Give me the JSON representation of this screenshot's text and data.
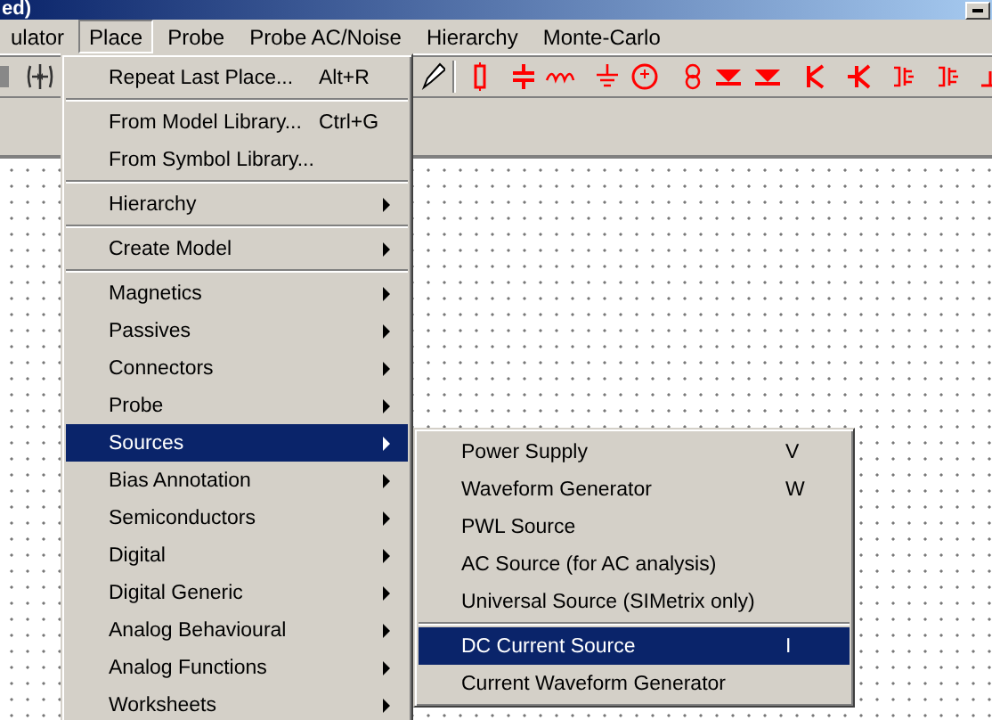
{
  "window": {
    "title": "ed)"
  },
  "menu_bar": [
    {
      "label": "ulator",
      "selected": false
    },
    {
      "label": "Place",
      "selected": true
    },
    {
      "label": "Probe",
      "selected": false
    },
    {
      "label": "Probe AC/Noise",
      "selected": false
    },
    {
      "label": "Hierarchy",
      "selected": false
    },
    {
      "label": "Monte-Carlo",
      "selected": false
    }
  ],
  "place_menu": {
    "items": [
      {
        "kind": "item",
        "label": "Repeat Last Place...",
        "shortcut": "Alt+R",
        "submenu": false,
        "selected": false
      },
      {
        "kind": "separator"
      },
      {
        "kind": "item",
        "label": "From Model Library...",
        "shortcut": "Ctrl+G",
        "submenu": false,
        "selected": false
      },
      {
        "kind": "item",
        "label": "From Symbol Library...",
        "submenu": false,
        "selected": false
      },
      {
        "kind": "separator"
      },
      {
        "kind": "item",
        "label": "Hierarchy",
        "submenu": true,
        "selected": false
      },
      {
        "kind": "separator"
      },
      {
        "kind": "item",
        "label": "Create Model",
        "submenu": true,
        "selected": false
      },
      {
        "kind": "separator"
      },
      {
        "kind": "item",
        "label": "Magnetics",
        "submenu": true,
        "selected": false
      },
      {
        "kind": "item",
        "label": "Passives",
        "submenu": true,
        "selected": false
      },
      {
        "kind": "item",
        "label": "Connectors",
        "submenu": true,
        "selected": false
      },
      {
        "kind": "item",
        "label": "Probe",
        "submenu": true,
        "selected": false
      },
      {
        "kind": "item",
        "label": "Sources",
        "submenu": true,
        "selected": true
      },
      {
        "kind": "item",
        "label": "Bias Annotation",
        "submenu": true,
        "selected": false
      },
      {
        "kind": "item",
        "label": "Semiconductors",
        "submenu": true,
        "selected": false
      },
      {
        "kind": "item",
        "label": "Digital",
        "submenu": true,
        "selected": false
      },
      {
        "kind": "item",
        "label": "Digital Generic",
        "submenu": true,
        "selected": false
      },
      {
        "kind": "item",
        "label": "Analog Behavioural",
        "submenu": true,
        "selected": false
      },
      {
        "kind": "item",
        "label": "Analog Functions",
        "submenu": true,
        "selected": false
      },
      {
        "kind": "item",
        "label": "Worksheets",
        "submenu": true,
        "selected": false
      }
    ]
  },
  "sources_submenu": {
    "items": [
      {
        "kind": "item",
        "label": "Power Supply",
        "shortcut": "V",
        "submenu": false,
        "selected": false
      },
      {
        "kind": "item",
        "label": "Waveform Generator",
        "shortcut": "W",
        "submenu": false,
        "selected": false
      },
      {
        "kind": "item",
        "label": "PWL Source",
        "submenu": false,
        "selected": false
      },
      {
        "kind": "item",
        "label": "AC Source (for AC analysis)",
        "submenu": false,
        "selected": false
      },
      {
        "kind": "item",
        "label": "Universal Source (SIMetrix only)",
        "submenu": false,
        "selected": false
      },
      {
        "kind": "separator"
      },
      {
        "kind": "item",
        "label": "DC Current Source",
        "shortcut": "I",
        "submenu": false,
        "selected": true
      },
      {
        "kind": "item",
        "label": "Current Waveform Generator",
        "submenu": false,
        "selected": false
      }
    ]
  }
}
